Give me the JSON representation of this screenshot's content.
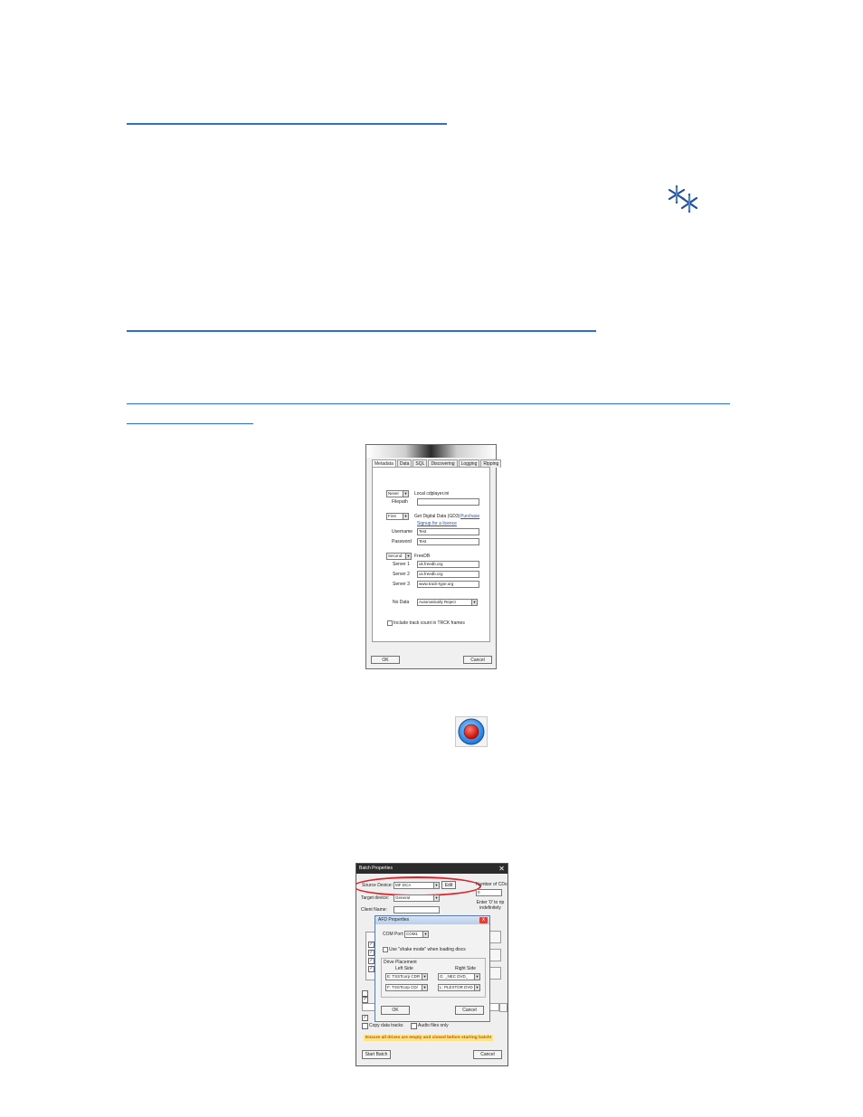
{
  "metadata_dialog": {
    "tabs": [
      "Metadata",
      "Data",
      "SQL",
      "Discovering",
      "Logging",
      "Ripping"
    ],
    "local_cdplayer": {
      "option": "Never",
      "label": "Local cdplayer.ini",
      "filepath_label": "Filepath",
      "filepath_value": ""
    },
    "gd3": {
      "option": "First",
      "label": "Get Digital Data (GD3)",
      "purchase_link": "Purchase",
      "signup_link": "Signup for a licence",
      "username_label": "Username",
      "username_value": "Test",
      "password_label": "Password",
      "password_value": "Test"
    },
    "freedb": {
      "option": "Second",
      "label": "FreeDB",
      "server1_label": "Server 1",
      "server1_value": "uk.freedb.org",
      "server2_label": "Server 2",
      "server2_value": "us.freedb.org",
      "server3_label": "Server 3",
      "server3_value": "www.track-type.org"
    },
    "no_data": {
      "label": "No Data",
      "value": "Automatically Reject"
    },
    "track_count_label": "Include track count in TRCK frames",
    "ok_label": "OK",
    "cancel_label": "Cancel"
  },
  "batch_dialog": {
    "title": "Batch Properties",
    "close_glyph": "✕",
    "source_device_label": "Source Device:",
    "source_device_value": "MF DCA",
    "edit_label": "Edit",
    "number_of_cds_label": "Number of CDs:",
    "number_of_cds_value": "0",
    "target_device_label": "Target device:",
    "target_device_value": "General",
    "client_name_label": "Client Name:",
    "enter_zero_note": "Enter '0' to rip indefinitely",
    "copy_data_tracks_label": "Copy data tracks",
    "audio_files_only_label": "Audio files only",
    "warning": "Ensure all drives are empty and closed before starting batch!",
    "start_batch_label": "Start Batch",
    "cancel_label": "Cancel"
  },
  "afd_dialog": {
    "title": "AFD Properties",
    "close_glyph": "x",
    "com_port_label": "COM Port:",
    "com_port_value": "COM1",
    "shake_mode_label": "Use \"shake mode\" when loading discs",
    "drive_placement_label": "Drive Placement",
    "left_side_label": "Left Side",
    "right_side_label": "Right Side",
    "left_drive_1": "E: TSSTcorp CDR",
    "left_drive_2": "F: TSSTcorp CD/",
    "right_drive_1": "G: _NEC    DVD_",
    "right_drive_2": "L: PLEXTOR  DVD",
    "ok_label": "OK",
    "cancel_label": "Cancel"
  },
  "colors": {
    "link_underline": "#2f6fce",
    "highlight_ellipse": "#e21f26",
    "warning_bg": "#fde48a",
    "warning_text": "#c25a00"
  },
  "icons": [
    "snowflake-icon",
    "record-button-icon"
  ]
}
